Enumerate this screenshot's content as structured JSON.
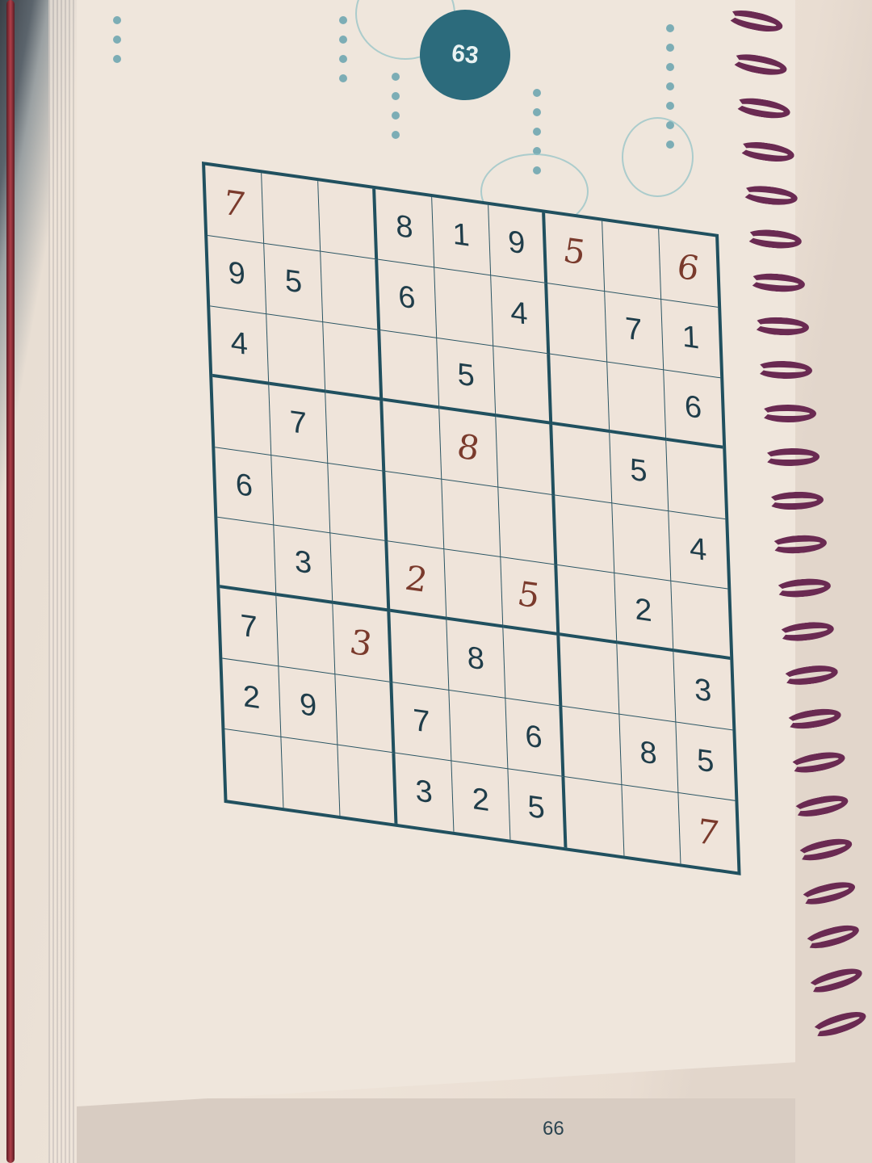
{
  "book": {
    "puzzle_number": "63",
    "page_number": "66"
  },
  "colors": {
    "ink": "#1f3d4a",
    "grid": "#20505f",
    "handwriting": "#7a3a2c",
    "badge": "#2c6b7c",
    "spiral": "#6a2a52"
  },
  "sudoku": {
    "printed": [
      [
        "",
        "",
        "",
        "8",
        "1",
        "9",
        "",
        "",
        ""
      ],
      [
        "9",
        "5",
        "",
        "6",
        "",
        "4",
        "",
        "7",
        "1"
      ],
      [
        "4",
        "",
        "",
        "",
        "5",
        "",
        "",
        "",
        "6"
      ],
      [
        "",
        "7",
        "",
        "",
        "",
        "",
        "",
        "5",
        ""
      ],
      [
        "6",
        "",
        "",
        "",
        "",
        "",
        "",
        "",
        "4"
      ],
      [
        "",
        "3",
        "",
        "",
        "",
        "",
        "",
        "2",
        ""
      ],
      [
        "7",
        "",
        "",
        "",
        "8",
        "",
        "",
        "",
        "3"
      ],
      [
        "2",
        "9",
        "",
        "7",
        "",
        "6",
        "",
        "8",
        "5"
      ],
      [
        "",
        "",
        "",
        "3",
        "2",
        "5",
        "",
        "",
        ""
      ]
    ],
    "handwritten": [
      [
        "7",
        "",
        "",
        "",
        "",
        "",
        "5",
        "",
        "6"
      ],
      [
        "",
        "",
        "",
        "",
        "",
        "",
        "",
        "",
        ""
      ],
      [
        "",
        "",
        "",
        "",
        "",
        "",
        "",
        "",
        ""
      ],
      [
        "",
        "",
        "",
        "",
        "8",
        "",
        "",
        "",
        ""
      ],
      [
        "",
        "",
        "",
        "",
        "",
        "",
        "",
        "",
        ""
      ],
      [
        "",
        "",
        "",
        "2",
        "",
        "5",
        "",
        "",
        ""
      ],
      [
        "",
        "",
        "3",
        "",
        "",
        "",
        "",
        "",
        ""
      ],
      [
        "",
        "",
        "",
        "",
        "",
        "",
        "",
        "",
        ""
      ],
      [
        "",
        "",
        "",
        "",
        "",
        "",
        "",
        "",
        "7"
      ]
    ]
  }
}
